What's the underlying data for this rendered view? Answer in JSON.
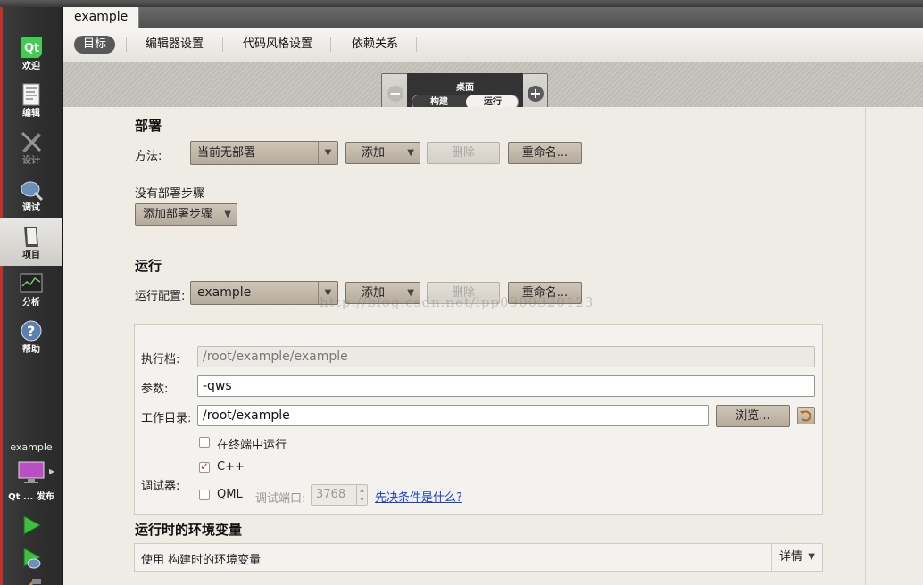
{
  "sidebar": {
    "items": [
      {
        "label": "欢迎",
        "icon": "qt-logo-icon"
      },
      {
        "label": "编辑",
        "icon": "document-icon"
      },
      {
        "label": "设计",
        "icon": "design-icon"
      },
      {
        "label": "调试",
        "icon": "bug-icon"
      },
      {
        "label": "项目",
        "icon": "project-icon"
      },
      {
        "label": "分析",
        "icon": "analyze-icon"
      },
      {
        "label": "帮助",
        "icon": "help-icon"
      }
    ],
    "kit_project": "example",
    "kit_target": "Qt ... 发布"
  },
  "doc_tab": "example",
  "subtabs": [
    "目标",
    "编辑器设置",
    "代码风格设置",
    "依赖关系"
  ],
  "target_selector": {
    "title": "桌面",
    "build": "构建",
    "run": "运行"
  },
  "deploy": {
    "heading": "部署",
    "method_label": "方法:",
    "method_value": "当前无部署",
    "add": "添加",
    "remove": "删除",
    "rename": "重命名...",
    "no_steps": "没有部署步骤",
    "add_step": "添加部署步骤"
  },
  "run": {
    "heading": "运行",
    "config_label": "运行配置:",
    "config_value": "example",
    "add": "添加",
    "remove": "删除",
    "rename": "重命名...",
    "executable_label": "执行档:",
    "executable_value": "/root/example/example",
    "args_label": "参数:",
    "args_value": "-qws",
    "workdir_label": "工作目录:",
    "workdir_value": "/root/example",
    "browse": "浏览...",
    "run_in_terminal": "在终端中运行",
    "debugger_label": "调试器:",
    "cpp": "C++",
    "qml": "QML",
    "debug_port_label": "调试端口:",
    "debug_port_value": "3768",
    "prereq_link": "先决条件是什么?"
  },
  "env": {
    "heading": "运行时的环境变量",
    "text": "使用 构建时的环境变量",
    "details": "详情"
  },
  "watermark": "http://blog.csdn.net/lpp0900320123"
}
